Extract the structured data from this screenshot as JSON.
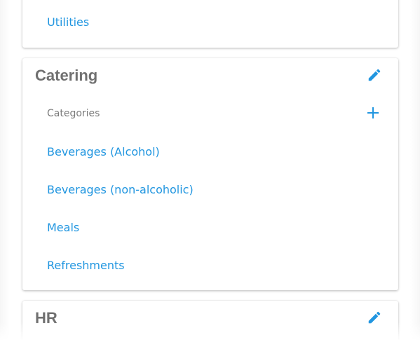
{
  "top_card": {
    "items": [
      {
        "label": "Utilities"
      }
    ]
  },
  "catering": {
    "title": "Catering",
    "section_label": "Categories",
    "items": [
      {
        "label": "Beverages (Alcohol)"
      },
      {
        "label": "Beverages (non-alcoholic)"
      },
      {
        "label": "Meals"
      },
      {
        "label": "Refreshments"
      }
    ]
  },
  "hr": {
    "title": "HR"
  },
  "icons": {
    "edit": "pencil-icon",
    "add": "plus-icon"
  },
  "colors": {
    "accent": "#2196e0",
    "title": "#707070",
    "label": "#7a7a7a"
  }
}
